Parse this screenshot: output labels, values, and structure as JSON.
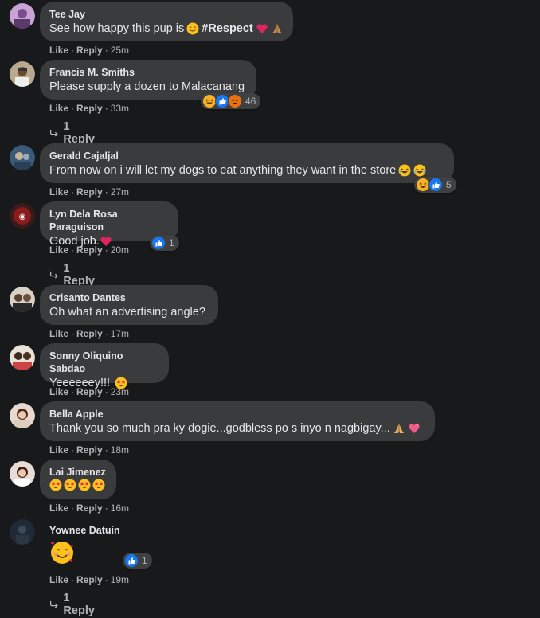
{
  "actions": {
    "like": "Like",
    "reply": "Reply",
    "sep": "·"
  },
  "colors": {
    "bubble": "#3a3b3c",
    "background": "#18191a",
    "like_blue": "#1877f2",
    "text": "#e4e6eb",
    "muted": "#b0b3b8"
  },
  "comments": [
    {
      "name": "Tee Jay",
      "text": "See how happy this pup is",
      "text_bold": "#Respect",
      "emojis": [
        "smiling-face-icon",
        "red-heart-icon",
        "folded-hands-icon"
      ],
      "time": "25m"
    },
    {
      "name": "Francis M. Smiths",
      "text": "Please supply a dozen to Malacanang",
      "reactions": [
        "haha",
        "like",
        "angry"
      ],
      "reaction_count": "46",
      "time": "33m",
      "replies": "1 Reply"
    },
    {
      "name": "Gerald Cajaljal",
      "text": "From now on i will let my dogs to eat anything they want in the store",
      "emojis": [
        "tears-of-joy-icon",
        "tears-of-joy-icon"
      ],
      "reactions": [
        "haha",
        "like"
      ],
      "reaction_count": "5",
      "time": "27m"
    },
    {
      "name": "Lyn Dela Rosa Paraguison",
      "text": "Good job.",
      "emojis": [
        "red-heart-icon"
      ],
      "reactions": [
        "like"
      ],
      "reaction_count": "1",
      "time": "20m",
      "replies": "1 Reply"
    },
    {
      "name": "Crisanto Dantes",
      "text": "Oh what an advertising angle?",
      "time": "17m"
    },
    {
      "name": "Sonny Oliquino Sabdao",
      "text": "Yeeeeeey!!!",
      "emojis": [
        "star-struck-icon"
      ],
      "time": "23m"
    },
    {
      "name": "Bella Apple",
      "text": "Thank you so much pra ky dogie...godbless po s inyo n nagbigay...",
      "emojis": [
        "folded-hands-icon",
        "sparkling-heart-icon"
      ],
      "time": "18m"
    },
    {
      "name": "Lai Jimenez",
      "text": "",
      "emojis": [
        "star-struck-icon",
        "star-struck-icon",
        "star-struck-icon",
        "star-struck-icon"
      ],
      "time": "16m"
    },
    {
      "name": "Yownee Datuin",
      "text": "",
      "emojis": [
        "smiling-face-with-hearts-icon"
      ],
      "reactions": [
        "like"
      ],
      "reaction_count": "1",
      "time": "19m",
      "replies": "1 Reply"
    }
  ]
}
